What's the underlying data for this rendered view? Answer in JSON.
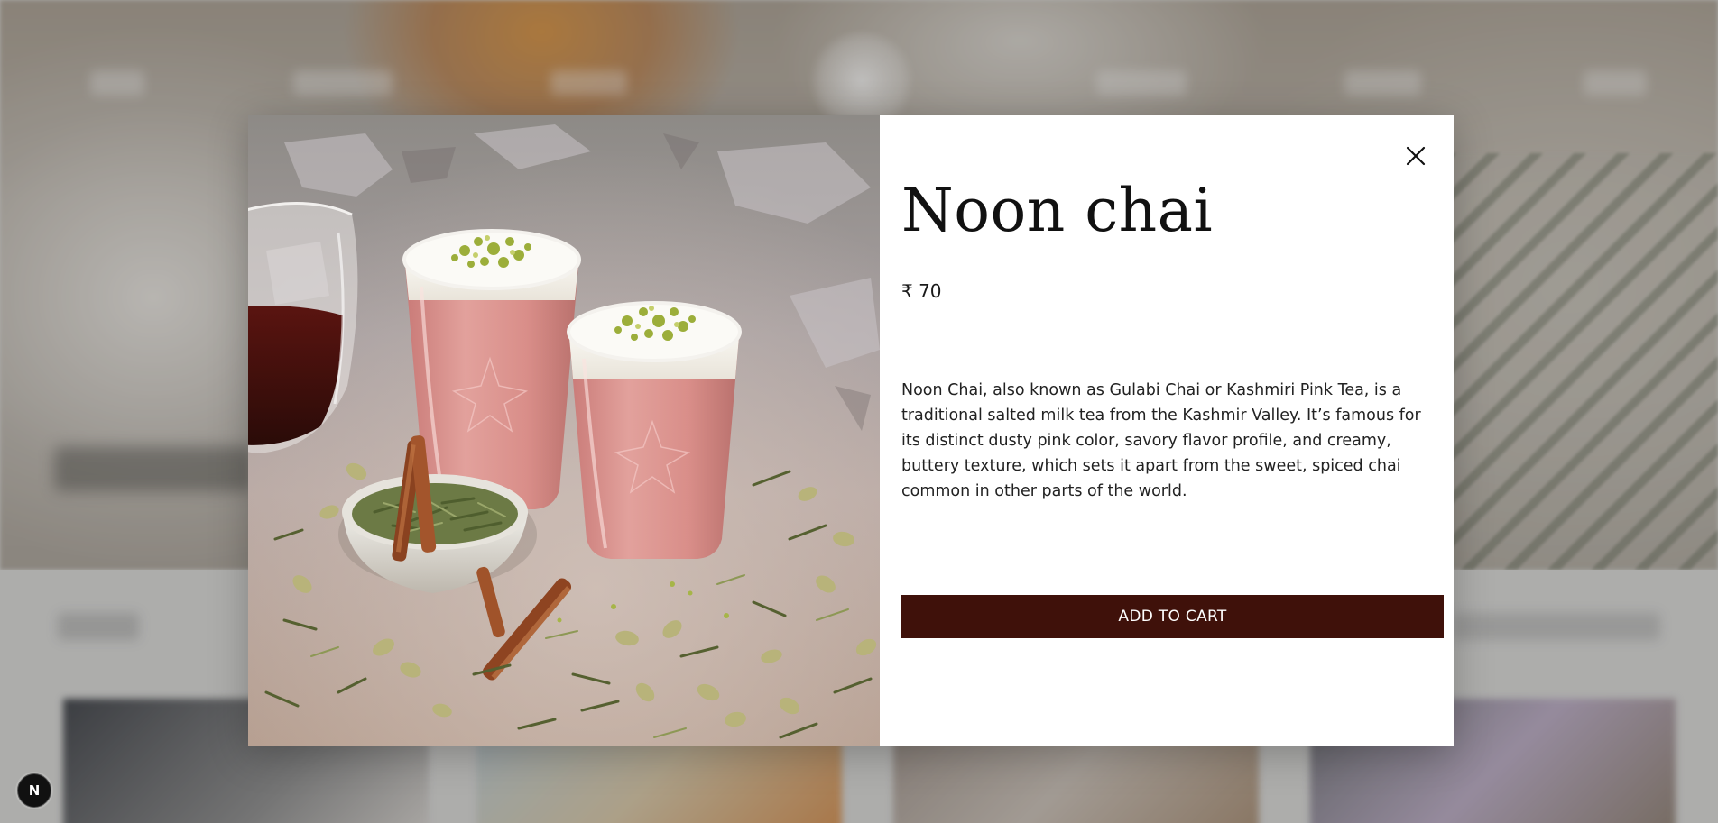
{
  "product": {
    "title": "Noon chai",
    "price": "₹ 70",
    "description": "Noon Chai, also known as Gulabi Chai or Kashmiri Pink Tea, is a traditional salted milk tea from the Kashmir Valley. It’s famous for its distinct dusty pink color, savory flavor profile, and creamy, buttery texture, which sets it apart from the sweet, spiced chai common in other parts of the world.",
    "add_to_cart_label": "ADD TO CART",
    "image_alt_name": "noon-chai-photo"
  },
  "modal": {
    "close_icon": "close-icon"
  },
  "dev_badge": {
    "label": "N"
  },
  "colors": {
    "cta_background": "#3f110a",
    "cta_text": "#ffffff",
    "modal_background": "#ffffff",
    "tea_pink": "#d88f8a"
  }
}
